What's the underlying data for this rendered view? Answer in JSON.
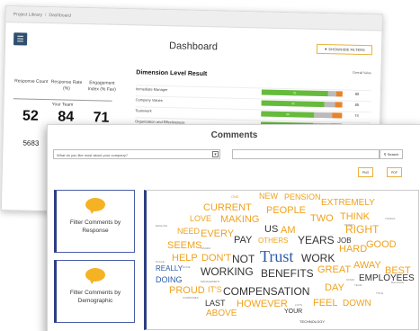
{
  "breadcrumb": [
    "Project Library",
    "Dashboard"
  ],
  "dashboard": {
    "menu_icon": "menu-icon",
    "title": "Dashboard",
    "show_filters_label": "SHOW/HIDE FILTERS",
    "stats": {
      "headers": [
        "Response Count",
        "Response Rate (%)",
        "Engagement Index (% Fav)"
      ],
      "your_team_label": "Your Team",
      "values": [
        "52",
        "84",
        "71"
      ],
      "secondary_value": "5683"
    },
    "dimension": {
      "title": "Dimension Level Result",
      "overall_header": "Overall Value",
      "rows": [
        {
          "label": "Immediate Manager",
          "fav": 0.82,
          "neutral": 0.1,
          "unfav": 0.08,
          "bar_label": "81",
          "value": "85"
        },
        {
          "label": "Company Values",
          "fav": 0.78,
          "neutral": 0.13,
          "unfav": 0.09,
          "bar_label": "78",
          "value": "85"
        },
        {
          "label": "Teamwork",
          "fav": 0.66,
          "neutral": 0.22,
          "unfav": 0.12,
          "bar_label": "66",
          "value": "74"
        },
        {
          "label": "Organization and Effectiveness",
          "fav": 0.64,
          "neutral": 0.23,
          "unfav": 0.13,
          "bar_label": "64",
          "value": "72"
        }
      ]
    }
  },
  "comments": {
    "title": "Comments",
    "question_placeholder": "What do you like most about your company?",
    "search_button": "Search",
    "png_label": "PNG",
    "pdf_label": "PDF",
    "panels": [
      {
        "line1": "Filter Comments by",
        "line2": "Response"
      },
      {
        "line1": "Filter Comments by",
        "line2": "Demographic"
      }
    ],
    "words": [
      "CURRENT",
      "NEW",
      "PENSION",
      "EXTREMELY",
      "PEOPLE",
      "LOVE",
      "MAKING",
      "THINK",
      "TWO",
      "NEED",
      "PAY",
      "US",
      "AM",
      "RIGHT",
      "EVERY",
      "OTHERS",
      "YEARS",
      "JOB",
      "SEEMS",
      "GOOD",
      "HARD",
      "HELP",
      "DON'T",
      "NOT",
      "Trust",
      "WORK",
      "AWAY",
      "BEST",
      "REALLY",
      "WORKING",
      "BENEFITS",
      "GREAT",
      "EMPLOYEES",
      "DOING",
      "PROUD",
      "IT'S",
      "COMPENSATION",
      "DAY",
      "HOWEVER",
      "FEEL",
      "LAST",
      "DOWN",
      "ABOVE",
      "YOUR",
      "ONE",
      "ENGLISH",
      "THINGS",
      "MONEY",
      "ISSUES",
      "STAFF",
      "TEAM",
      "MANAGEMENT",
      "BALANCE",
      "COMPANIES",
      "TECHNOLOGY",
      "TITLE",
      "PLACE",
      "DONE",
      "LOTS"
    ],
    "colors": {
      "accent": "#f0a21c",
      "dark": "#333333",
      "blue": "#2a5aa8",
      "panel_border": "#2c3e82"
    }
  }
}
